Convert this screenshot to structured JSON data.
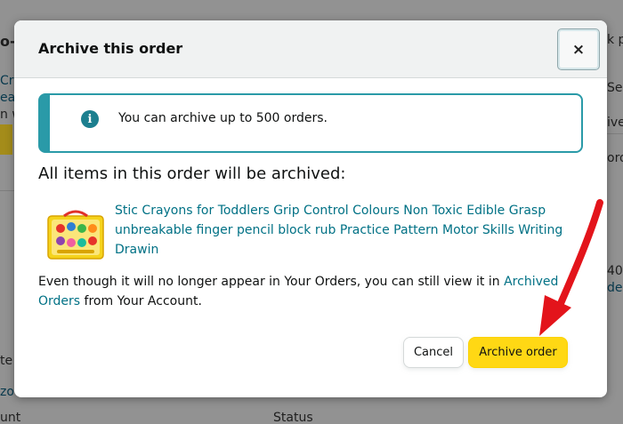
{
  "background": {
    "fragments": [
      "o-",
      "Cra",
      "ea",
      "n w",
      "Selle",
      "ive",
      "orod",
      "40",
      "de",
      "te",
      "zo",
      "unt",
      "Status",
      "k pa"
    ]
  },
  "modal": {
    "title": "Archive this order",
    "close_label": "×",
    "info": {
      "icon": "i",
      "text": "You can archive up to 500 orders."
    },
    "heading": "All items in this order will be archived:",
    "item": {
      "title": "Stic Crayons for Toddlers Grip Control Colours Non Toxic Edible Grasp unbreakable finger pencil block rub Practice Pattern Motor Skills Writing Drawin"
    },
    "note": {
      "before": "Even though it will no longer appear in Your Orders, you can still view it in ",
      "link": "Archived Orders",
      "after": " from Your Account."
    },
    "buttons": {
      "cancel": "Cancel",
      "archive": "Archive order"
    }
  },
  "colors": {
    "link": "#007185",
    "primary_button": "#ffd814",
    "info_border": "#2a9aa8",
    "annotation_arrow": "#e3141b"
  }
}
